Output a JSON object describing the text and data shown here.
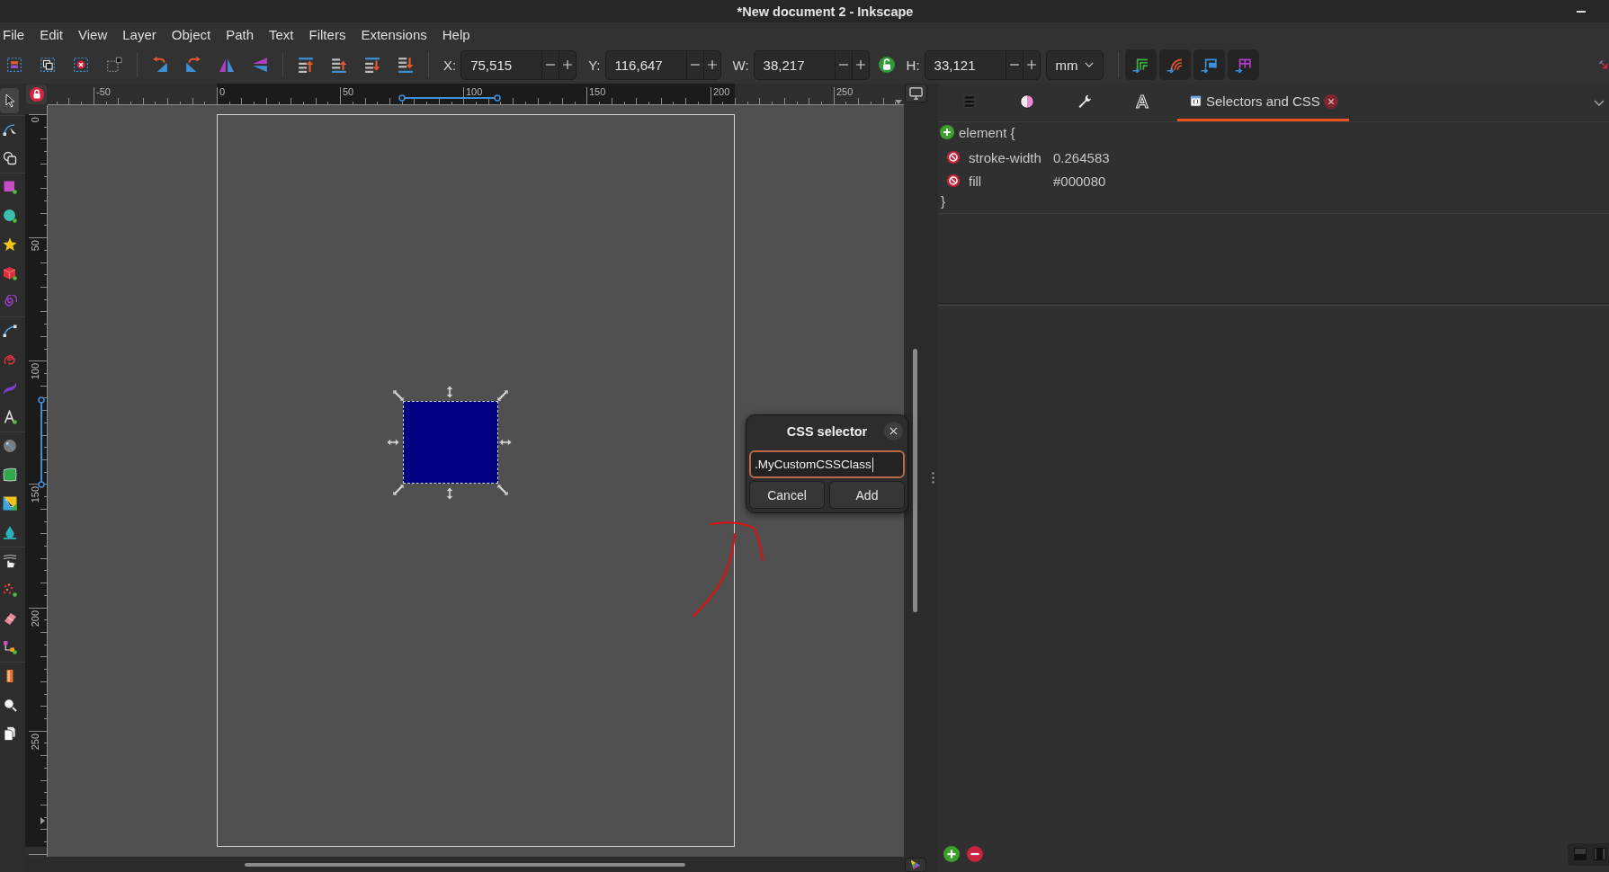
{
  "window": {
    "title": "*New document 2 - Inkscape"
  },
  "menu": [
    "File",
    "Edit",
    "View",
    "Layer",
    "Object",
    "Path",
    "Text",
    "Filters",
    "Extensions",
    "Help"
  ],
  "toolbar": {
    "fields": [
      {
        "label": "X:",
        "value": "75,515"
      },
      {
        "label": "Y:",
        "value": "116,647"
      },
      {
        "label": "W:",
        "value": "38,217"
      },
      {
        "label": "H:",
        "value": "33,121"
      }
    ],
    "lock": {
      "locked": false
    },
    "unit": "mm",
    "toggles": [
      {
        "on": true
      },
      {
        "on": true
      },
      {
        "on": true
      },
      {
        "on": true
      }
    ]
  },
  "toolbox": {
    "tools": [
      {
        "selected": true
      },
      {
        "selected": false
      },
      {
        "selected": false
      },
      {
        "selected": false
      },
      {
        "selected": false
      },
      {
        "selected": false
      },
      {
        "selected": false
      },
      {
        "selected": false
      },
      {
        "selected": false
      },
      {
        "selected": false
      },
      {
        "selected": false
      },
      {
        "selected": false
      },
      {
        "selected": false
      },
      {
        "selected": false
      },
      {
        "selected": false
      },
      {
        "selected": false
      },
      {
        "selected": false
      },
      {
        "selected": false
      },
      {
        "selected": false
      },
      {
        "selected": false
      },
      {
        "selected": false
      },
      {
        "selected": false
      },
      {
        "selected": false
      }
    ]
  },
  "rulers": {
    "horizontal": [
      "-50",
      "0",
      "50",
      "100",
      "150",
      "200",
      "250"
    ],
    "vertical": [
      "0",
      "50",
      "100",
      "150",
      "200",
      "250"
    ]
  },
  "canvas": {
    "object": {
      "selected": true
    }
  },
  "dialog": {
    "title": "CSS selector",
    "input": {
      "value": ".MyCustomCSSClass",
      "focused": true
    },
    "buttons": [
      "Cancel",
      "Add"
    ]
  },
  "panel": {
    "tabs": [
      {
        "selected": false
      },
      {
        "selected": false
      },
      {
        "selected": false
      },
      {
        "selected": false
      },
      {
        "label": "Selectors and CSS",
        "selected": true
      }
    ],
    "rule": {
      "selector": "element {",
      "properties": [
        {
          "name": "stroke-width",
          "value": "0.264583"
        },
        {
          "name": "fill",
          "value": "#000080"
        }
      ],
      "closing": "}"
    }
  }
}
